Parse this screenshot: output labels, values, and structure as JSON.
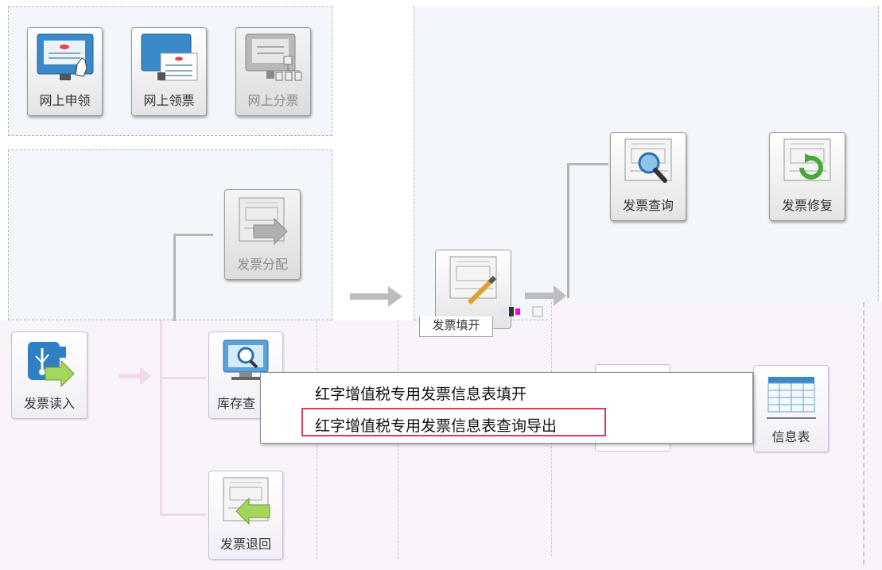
{
  "top_left_buttons": {
    "online_apply": "网上申领",
    "online_receive": "网上领票",
    "online_distribute": "网上分票"
  },
  "mid_left_buttons": {
    "invoice_allocate": "发票分配"
  },
  "right_buttons": {
    "invoice_query": "发票查询",
    "invoice_repair": "发票修复",
    "invoice_fill": "发票填开"
  },
  "lower_buttons": {
    "invoice_read": "发票读入",
    "stock_query": "库存查",
    "invoice_return": "发票退回",
    "info_table": "信息表"
  },
  "context_menu": {
    "item1": "红字增值税专用发票信息表填开",
    "item2": "红字增值税专用发票信息表查询导出"
  },
  "colors": {
    "highlight_border": "#e23b5b",
    "panel_bg": "#f3f6fa",
    "pink_bg": "#fbf3fa"
  }
}
